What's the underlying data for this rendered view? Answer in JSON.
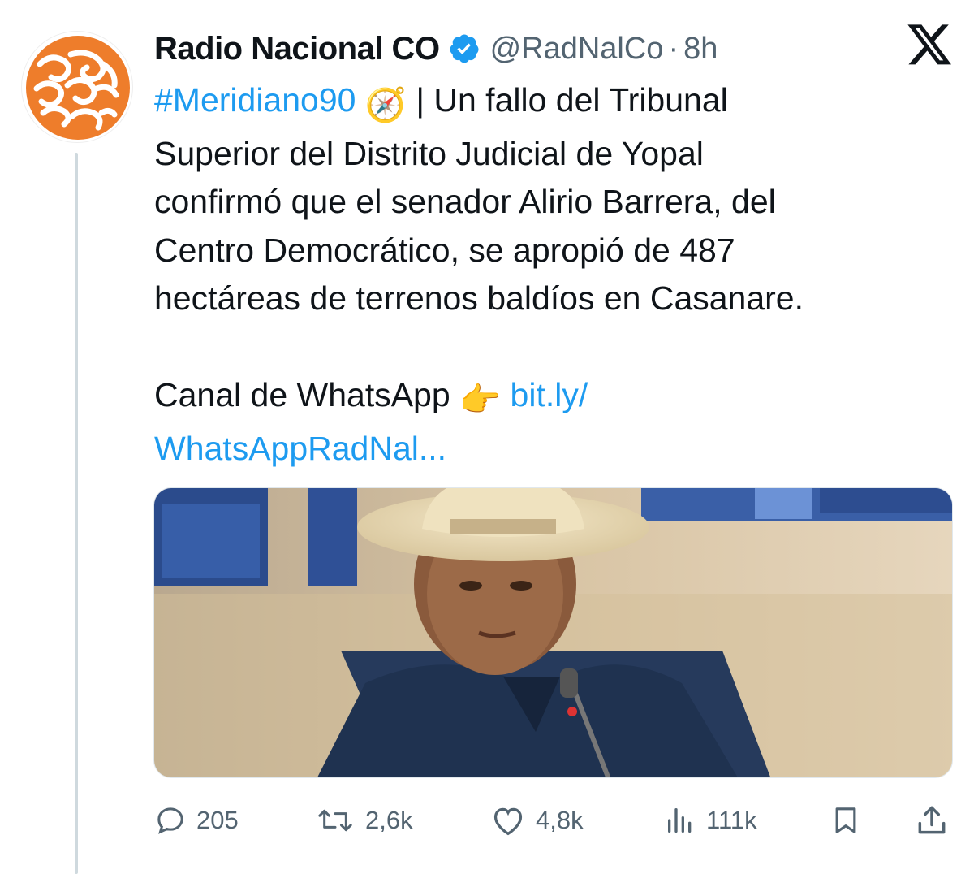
{
  "author": {
    "name": "Radio Nacional CO",
    "handle": "@RadNalCo",
    "separator": "·",
    "time": "8h",
    "avatar_icon": "radio-nacional-swirl-logo",
    "verified_icon": "verified-badge-icon"
  },
  "brand": {
    "accent": "#1d9bf0",
    "avatar_color": "#ee7d2b",
    "text": "#0f1419",
    "muted": "#536471"
  },
  "tweet": {
    "hashtag": "#Meridiano90",
    "hashtag_emoji": "🧭",
    "line1_rest": "| Un fallo del Tribunal",
    "line2": "Superior del Distrito Judicial de Yopal",
    "line3": "confirmó que el senador Alirio Barrera, del",
    "line4": "Centro Democrático, se apropió de 487",
    "line5": "hectáreas de terrenos baldíos en Casanare.",
    "whatsapp_label": "Canal de WhatsApp",
    "pointing_emoji": "👉",
    "link_part1": "bit.ly/",
    "link_part2": "WhatsAppRadNal..."
  },
  "media": {
    "description_icon": "photo-senator-cowboy-hat"
  },
  "actions": {
    "replies": "205",
    "reposts": "2,6k",
    "likes": "4,8k",
    "views": "111k"
  }
}
